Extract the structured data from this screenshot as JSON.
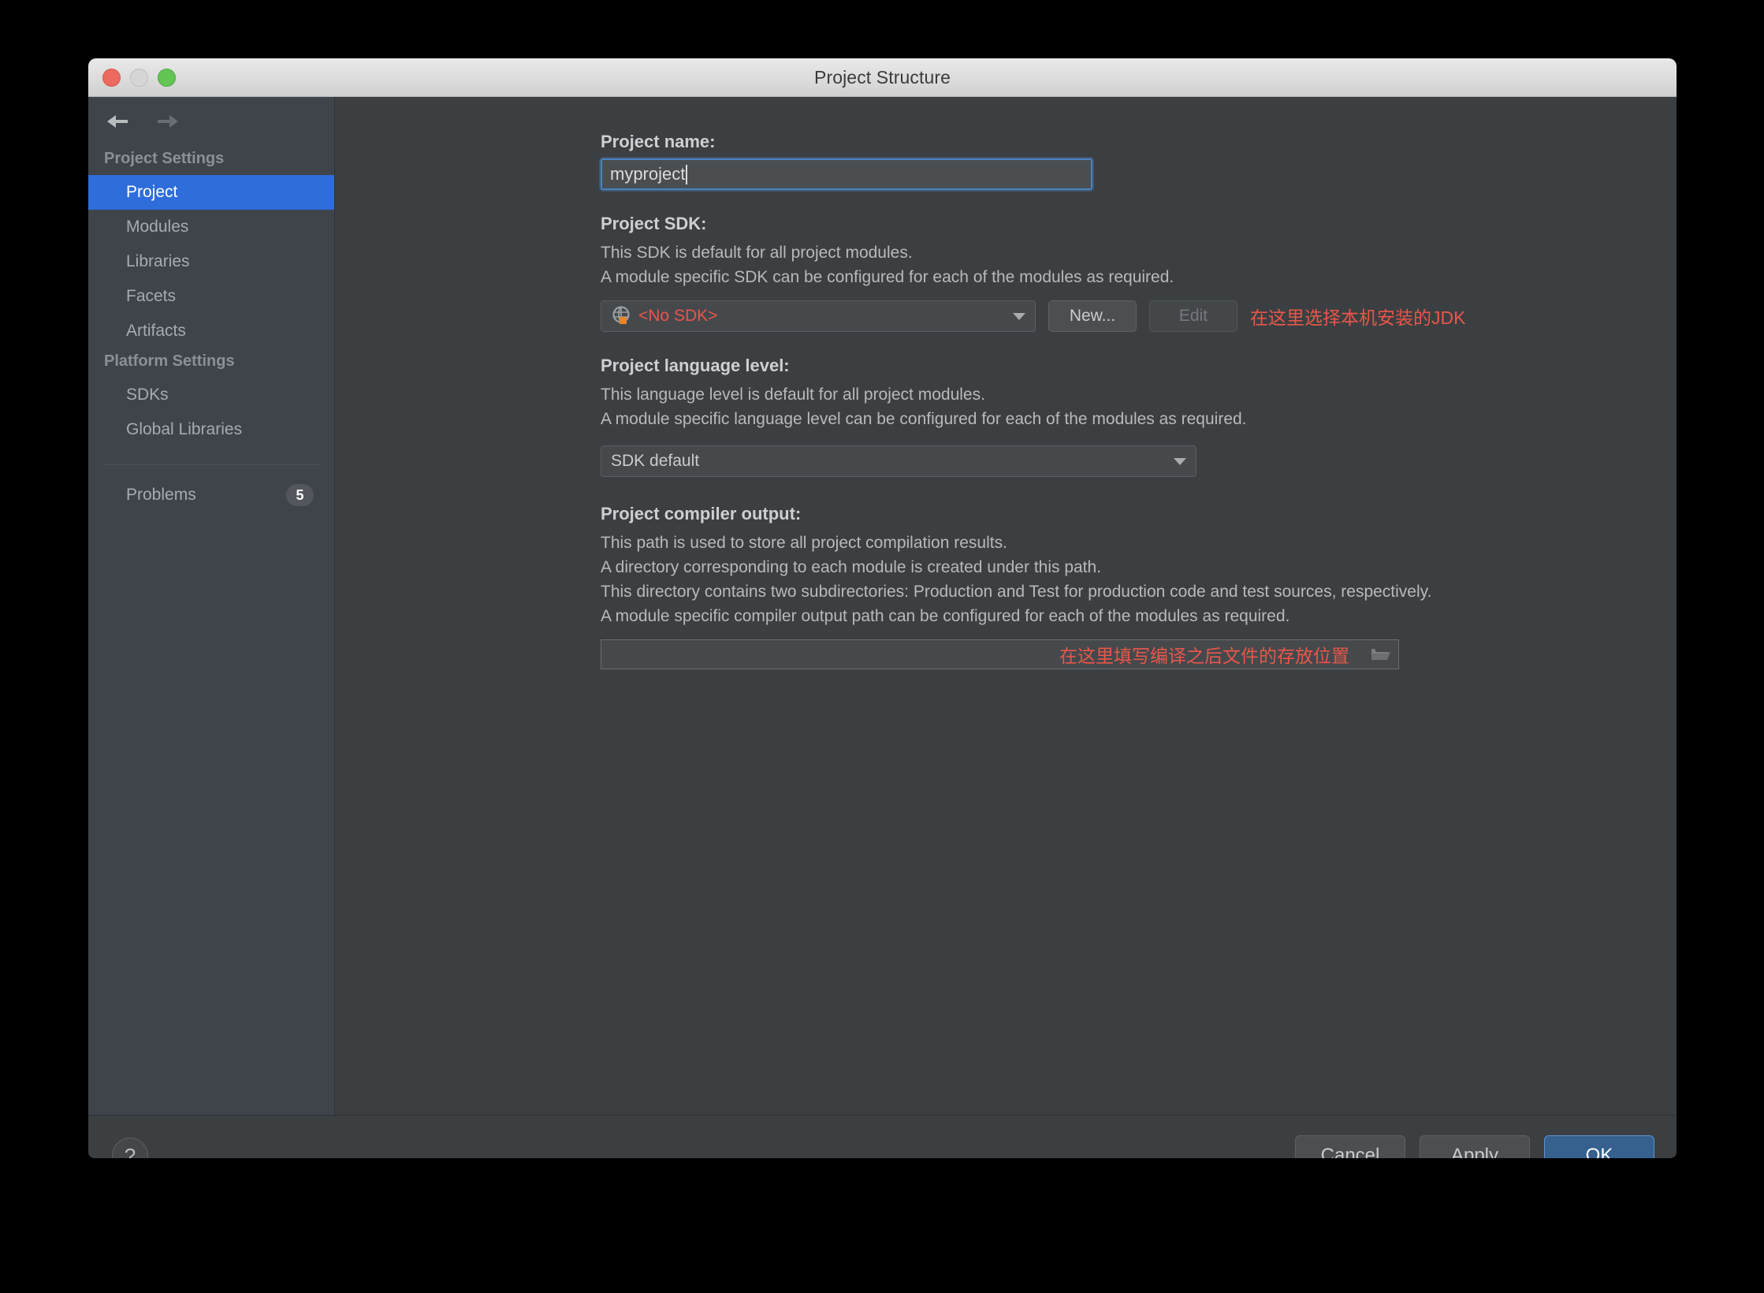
{
  "window": {
    "title": "Project Structure",
    "traffic_lights": [
      "close-button",
      "minimize-button",
      "zoom-button"
    ]
  },
  "nav": {
    "back_icon": "arrow-left-icon",
    "forward_icon": "arrow-right-icon"
  },
  "sidebar": {
    "groups": [
      {
        "title": "Project Settings",
        "items": [
          {
            "label": "Project",
            "selected": true
          },
          {
            "label": "Modules",
            "selected": false
          },
          {
            "label": "Libraries",
            "selected": false
          },
          {
            "label": "Facets",
            "selected": false
          },
          {
            "label": "Artifacts",
            "selected": false
          }
        ]
      },
      {
        "title": "Platform Settings",
        "items": [
          {
            "label": "SDKs",
            "selected": false
          },
          {
            "label": "Global Libraries",
            "selected": false
          }
        ]
      }
    ],
    "problems": {
      "label": "Problems",
      "count": "5"
    }
  },
  "main": {
    "project_name": {
      "label": "Project name:",
      "value": "myproject"
    },
    "project_sdk": {
      "label": "Project SDK:",
      "desc_line1": "This SDK is default for all project modules.",
      "desc_line2": "A module specific SDK can be configured for each of the modules as required.",
      "selected": "<No SDK>",
      "selected_color": "#e8564a",
      "icon": "sdk-globe-icon",
      "new_button": "New...",
      "edit_button": "Edit",
      "annotation": "在这里选择本机安装的JDK"
    },
    "language_level": {
      "label": "Project language level:",
      "desc_line1": "This language level is default for all project modules.",
      "desc_line2": "A module specific language level can be configured for each of the modules as required.",
      "selected": "SDK default"
    },
    "compiler_output": {
      "label": "Project compiler output:",
      "desc_line1": "This path is used to store all project compilation results.",
      "desc_line2": "A directory corresponding to each module is created under this path.",
      "desc_line3": "This directory contains two subdirectories: Production and Test for production code and test sources, respectively.",
      "desc_line4": "A module specific compiler output path can be configured for each of the modules as required.",
      "value": "",
      "annotation": "在这里填写编译之后文件的存放位置",
      "browse_icon": "folder-icon"
    }
  },
  "footer": {
    "help_label": "?",
    "cancel_label": "Cancel",
    "apply_label": "Apply",
    "ok_label": "OK"
  },
  "colors": {
    "accent_blue": "#2f6ddb",
    "annotation_red": "#e8564a",
    "panel_bg": "#3c3f41",
    "sidebar_bg": "#3f444b",
    "primary_button": "#36618f"
  }
}
